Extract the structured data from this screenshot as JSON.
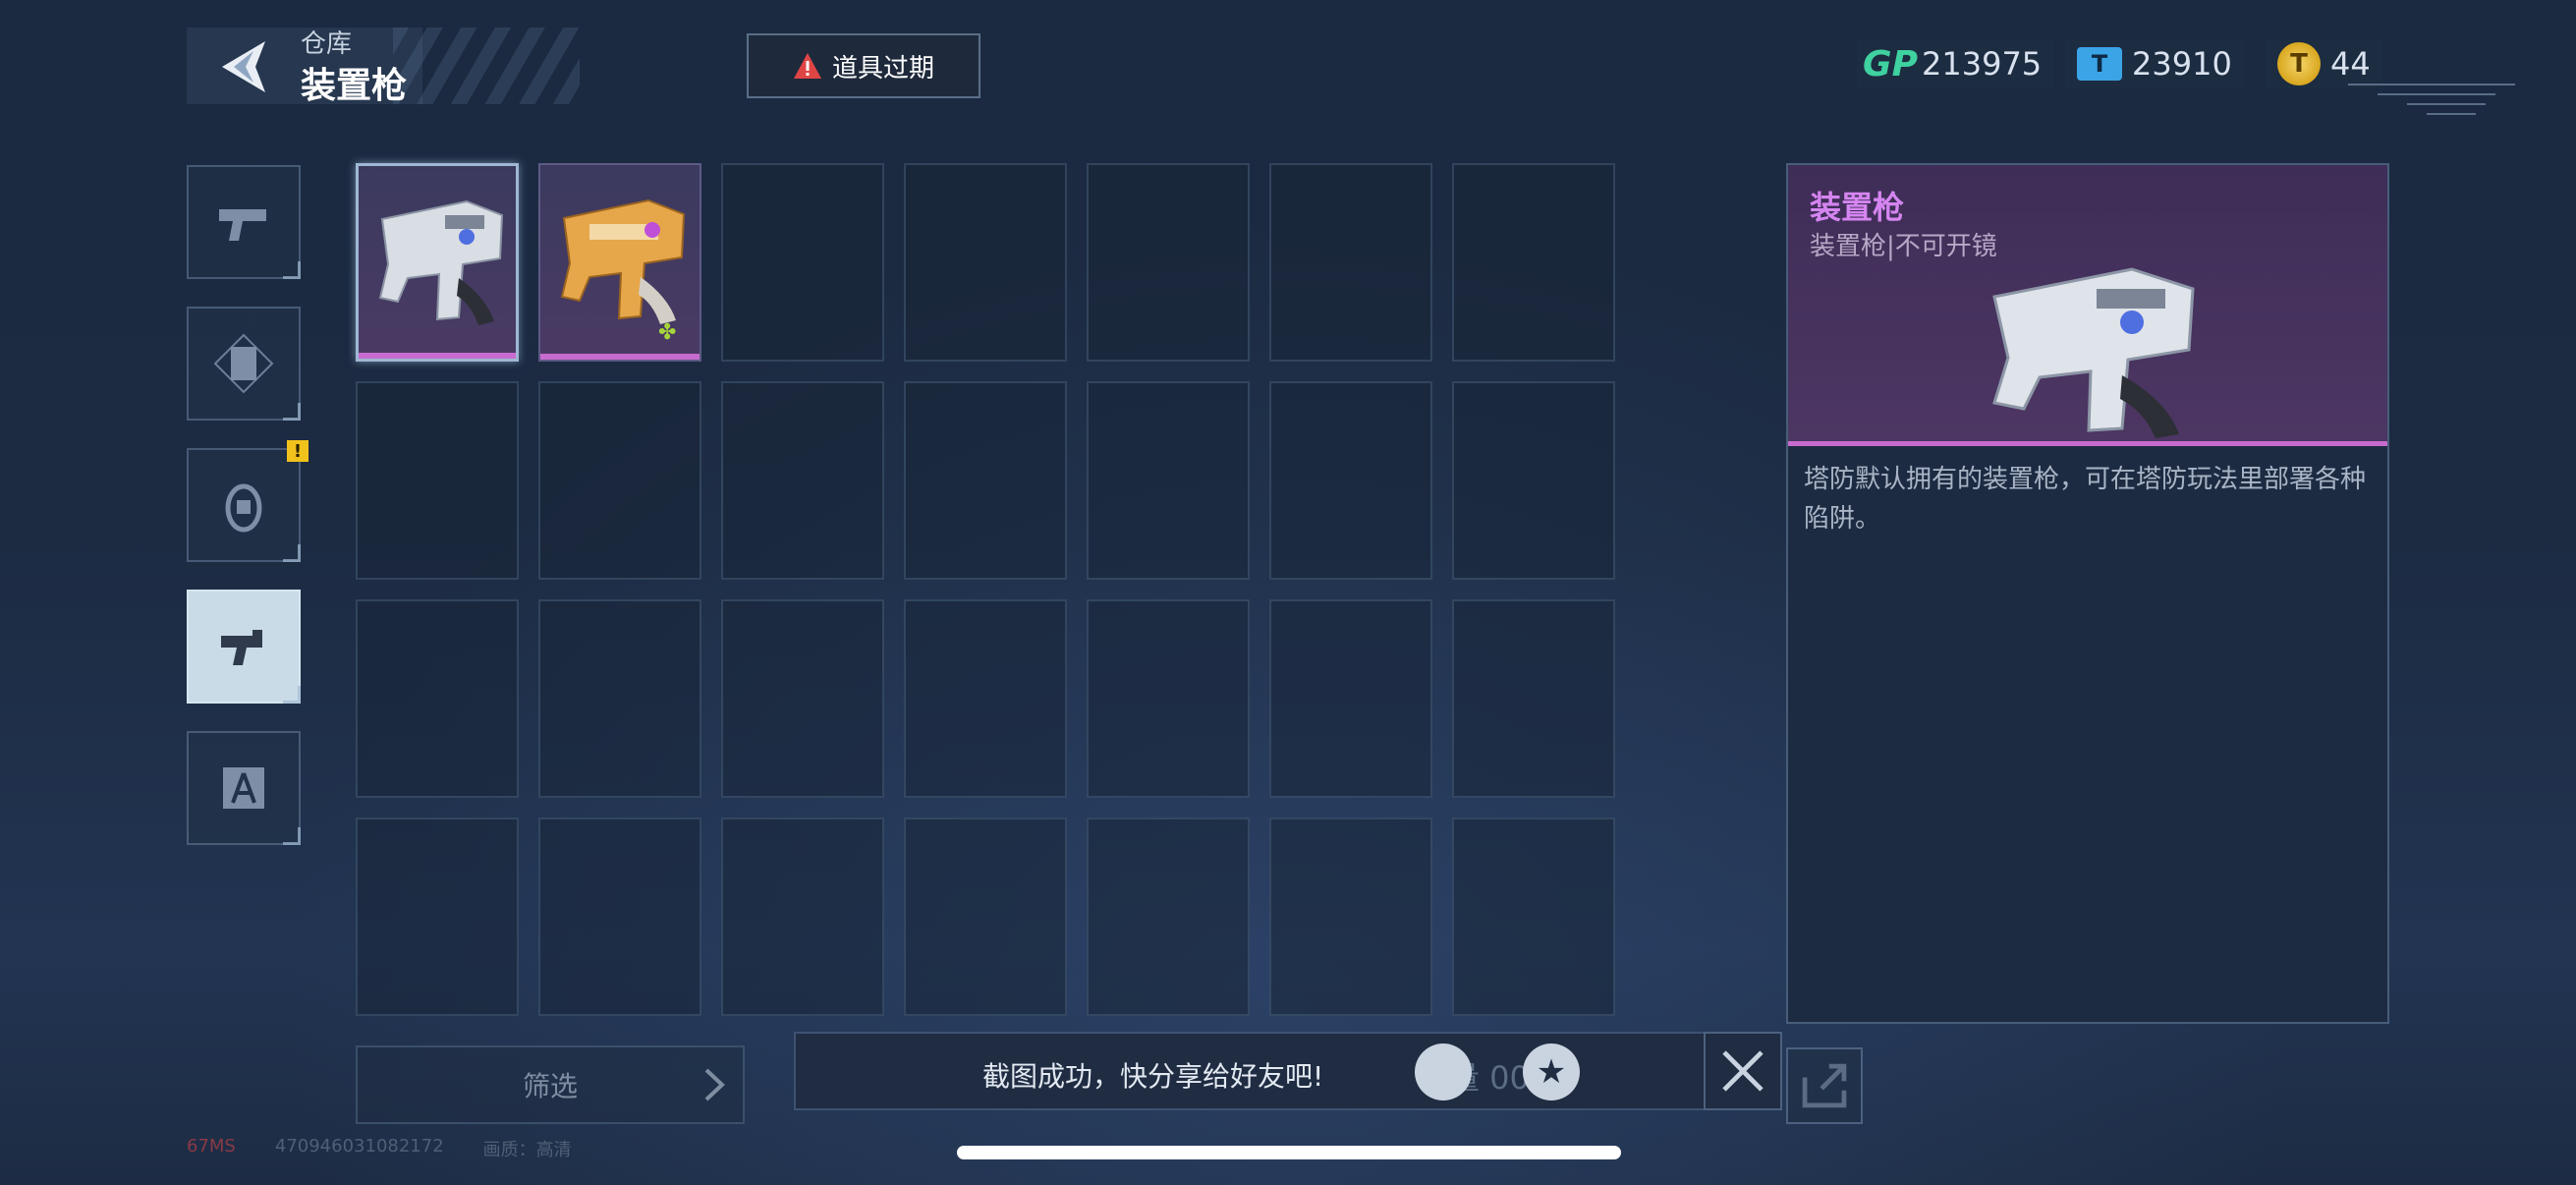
{
  "header": {
    "subtitle": "仓库",
    "title": "装置枪",
    "expired_button": "道具过期"
  },
  "currencies": [
    {
      "icon": "gp-icon",
      "label": "GP",
      "value": "213975"
    },
    {
      "icon": "ticket-icon",
      "label": "",
      "value": "23910"
    },
    {
      "icon": "coin-icon",
      "label": "",
      "value": "44"
    }
  ],
  "side_tabs": [
    {
      "name": "pistol-icon",
      "active": false,
      "notification": false
    },
    {
      "name": "scroll-icon",
      "active": false,
      "notification": false
    },
    {
      "name": "grenade-icon",
      "active": false,
      "notification": true
    },
    {
      "name": "device-gun-icon",
      "active": true,
      "notification": false
    },
    {
      "name": "compass-icon",
      "active": false,
      "notification": false
    }
  ],
  "notification_mark": "!",
  "inventory": {
    "rows": 4,
    "cols": 7,
    "items": [
      {
        "name": "device-gun-silver",
        "variant": "silver",
        "selected": true
      },
      {
        "name": "device-gun-gold",
        "variant": "gold",
        "selected": false,
        "badge": "puzzle-icon"
      }
    ]
  },
  "detail": {
    "name": "装置枪",
    "type": "装置枪|不可开镜",
    "description": "塔防默认拥有的装置枪，可在塔防玩法里部署各种陷阱。"
  },
  "filter": {
    "label": "筛选"
  },
  "toast": {
    "text": "截图成功，快分享给好友吧!",
    "capacity_text": "容量 00"
  },
  "debug": {
    "latency": "67MS",
    "id": "470946031082172",
    "quality": "画质：高清"
  },
  "colors": {
    "rarity_purple": "#c86bd0",
    "gp_green": "#3fd1a0",
    "ticket_blue": "#3ba4e6",
    "coin_gold": "#d9a71f",
    "notify_yellow": "#f1c21b"
  }
}
